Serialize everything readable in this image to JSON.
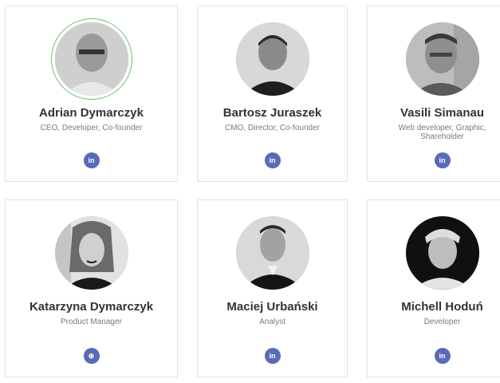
{
  "team": [
    {
      "name": "Adrian Dymarczyk",
      "role": "CEO, Developer, Co-founder",
      "social": "linkedin-icon",
      "social_glyph": "in"
    },
    {
      "name": "Bartosz Juraszek",
      "role": "CMO, Director, Co-founder",
      "social": "linkedin-icon",
      "social_glyph": "in"
    },
    {
      "name": "Vasili Simanau",
      "role": "Web developer, Graphic, Shareholder",
      "social": "linkedin-icon",
      "social_glyph": "in"
    },
    {
      "name": "Katarzyna Dymarczyk",
      "role": "Product Manager",
      "social": "globe-icon",
      "social_glyph": "⊕"
    },
    {
      "name": "Maciej Urbański",
      "role": "Analyst",
      "social": "linkedin-icon",
      "social_glyph": "in"
    },
    {
      "name": "Michell Hoduń",
      "role": "Developer",
      "social": "linkedin-icon",
      "social_glyph": "in"
    }
  ],
  "colors": {
    "accent": "#5a6ab8",
    "highlight_ring": "#6fc36f",
    "card_border": "#e3e3e3",
    "name_text": "#333333",
    "role_text": "#7a7a7a"
  }
}
